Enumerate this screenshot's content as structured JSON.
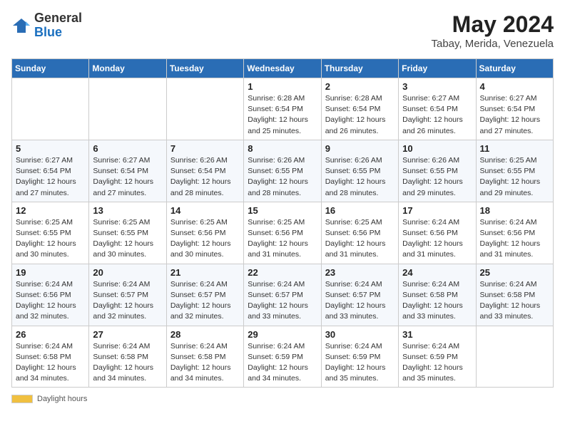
{
  "header": {
    "logo_general": "General",
    "logo_blue": "Blue",
    "title": "May 2024",
    "subtitle": "Tabay, Merida, Venezuela"
  },
  "days_of_week": [
    "Sunday",
    "Monday",
    "Tuesday",
    "Wednesday",
    "Thursday",
    "Friday",
    "Saturday"
  ],
  "weeks": [
    [
      {
        "day": "",
        "info": ""
      },
      {
        "day": "",
        "info": ""
      },
      {
        "day": "",
        "info": ""
      },
      {
        "day": "1",
        "info": "Sunrise: 6:28 AM\nSunset: 6:54 PM\nDaylight: 12 hours\nand 25 minutes."
      },
      {
        "day": "2",
        "info": "Sunrise: 6:28 AM\nSunset: 6:54 PM\nDaylight: 12 hours\nand 26 minutes."
      },
      {
        "day": "3",
        "info": "Sunrise: 6:27 AM\nSunset: 6:54 PM\nDaylight: 12 hours\nand 26 minutes."
      },
      {
        "day": "4",
        "info": "Sunrise: 6:27 AM\nSunset: 6:54 PM\nDaylight: 12 hours\nand 27 minutes."
      }
    ],
    [
      {
        "day": "5",
        "info": "Sunrise: 6:27 AM\nSunset: 6:54 PM\nDaylight: 12 hours\nand 27 minutes."
      },
      {
        "day": "6",
        "info": "Sunrise: 6:27 AM\nSunset: 6:54 PM\nDaylight: 12 hours\nand 27 minutes."
      },
      {
        "day": "7",
        "info": "Sunrise: 6:26 AM\nSunset: 6:54 PM\nDaylight: 12 hours\nand 28 minutes."
      },
      {
        "day": "8",
        "info": "Sunrise: 6:26 AM\nSunset: 6:55 PM\nDaylight: 12 hours\nand 28 minutes."
      },
      {
        "day": "9",
        "info": "Sunrise: 6:26 AM\nSunset: 6:55 PM\nDaylight: 12 hours\nand 28 minutes."
      },
      {
        "day": "10",
        "info": "Sunrise: 6:26 AM\nSunset: 6:55 PM\nDaylight: 12 hours\nand 29 minutes."
      },
      {
        "day": "11",
        "info": "Sunrise: 6:25 AM\nSunset: 6:55 PM\nDaylight: 12 hours\nand 29 minutes."
      }
    ],
    [
      {
        "day": "12",
        "info": "Sunrise: 6:25 AM\nSunset: 6:55 PM\nDaylight: 12 hours\nand 30 minutes."
      },
      {
        "day": "13",
        "info": "Sunrise: 6:25 AM\nSunset: 6:55 PM\nDaylight: 12 hours\nand 30 minutes."
      },
      {
        "day": "14",
        "info": "Sunrise: 6:25 AM\nSunset: 6:56 PM\nDaylight: 12 hours\nand 30 minutes."
      },
      {
        "day": "15",
        "info": "Sunrise: 6:25 AM\nSunset: 6:56 PM\nDaylight: 12 hours\nand 31 minutes."
      },
      {
        "day": "16",
        "info": "Sunrise: 6:25 AM\nSunset: 6:56 PM\nDaylight: 12 hours\nand 31 minutes."
      },
      {
        "day": "17",
        "info": "Sunrise: 6:24 AM\nSunset: 6:56 PM\nDaylight: 12 hours\nand 31 minutes."
      },
      {
        "day": "18",
        "info": "Sunrise: 6:24 AM\nSunset: 6:56 PM\nDaylight: 12 hours\nand 31 minutes."
      }
    ],
    [
      {
        "day": "19",
        "info": "Sunrise: 6:24 AM\nSunset: 6:56 PM\nDaylight: 12 hours\nand 32 minutes."
      },
      {
        "day": "20",
        "info": "Sunrise: 6:24 AM\nSunset: 6:57 PM\nDaylight: 12 hours\nand 32 minutes."
      },
      {
        "day": "21",
        "info": "Sunrise: 6:24 AM\nSunset: 6:57 PM\nDaylight: 12 hours\nand 32 minutes."
      },
      {
        "day": "22",
        "info": "Sunrise: 6:24 AM\nSunset: 6:57 PM\nDaylight: 12 hours\nand 33 minutes."
      },
      {
        "day": "23",
        "info": "Sunrise: 6:24 AM\nSunset: 6:57 PM\nDaylight: 12 hours\nand 33 minutes."
      },
      {
        "day": "24",
        "info": "Sunrise: 6:24 AM\nSunset: 6:58 PM\nDaylight: 12 hours\nand 33 minutes."
      },
      {
        "day": "25",
        "info": "Sunrise: 6:24 AM\nSunset: 6:58 PM\nDaylight: 12 hours\nand 33 minutes."
      }
    ],
    [
      {
        "day": "26",
        "info": "Sunrise: 6:24 AM\nSunset: 6:58 PM\nDaylight: 12 hours\nand 34 minutes."
      },
      {
        "day": "27",
        "info": "Sunrise: 6:24 AM\nSunset: 6:58 PM\nDaylight: 12 hours\nand 34 minutes."
      },
      {
        "day": "28",
        "info": "Sunrise: 6:24 AM\nSunset: 6:58 PM\nDaylight: 12 hours\nand 34 minutes."
      },
      {
        "day": "29",
        "info": "Sunrise: 6:24 AM\nSunset: 6:59 PM\nDaylight: 12 hours\nand 34 minutes."
      },
      {
        "day": "30",
        "info": "Sunrise: 6:24 AM\nSunset: 6:59 PM\nDaylight: 12 hours\nand 35 minutes."
      },
      {
        "day": "31",
        "info": "Sunrise: 6:24 AM\nSunset: 6:59 PM\nDaylight: 12 hours\nand 35 minutes."
      },
      {
        "day": "",
        "info": ""
      }
    ]
  ],
  "footer": {
    "legend_label": "Daylight hours"
  }
}
